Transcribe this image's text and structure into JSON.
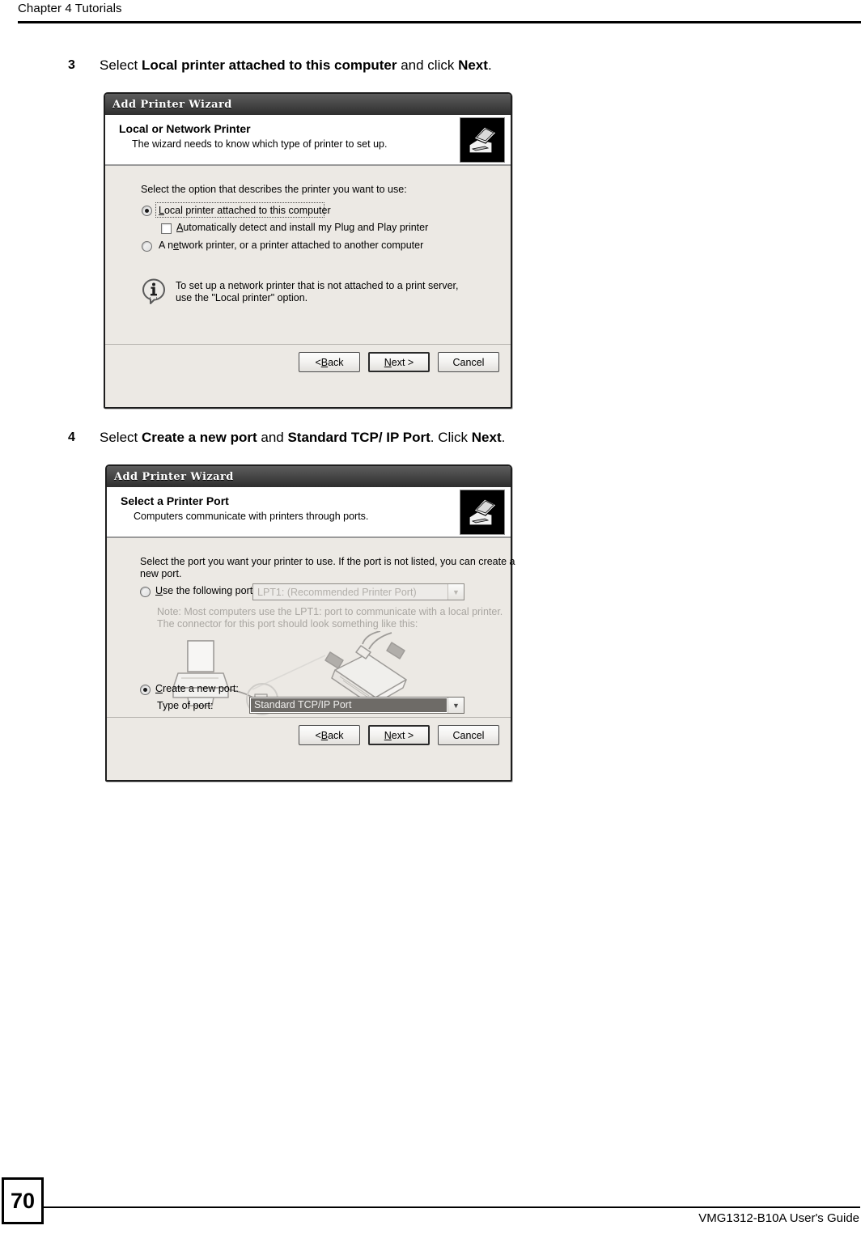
{
  "page": {
    "chapter_header": "Chapter 4 Tutorials",
    "page_number": "70",
    "guide_name": "VMG1312-B10A User's Guide"
  },
  "steps": [
    {
      "number": "3",
      "segments": [
        {
          "text": "Select ",
          "bold": false
        },
        {
          "text": "Local printer attached to this computer",
          "bold": true
        },
        {
          "text": " and click ",
          "bold": false
        },
        {
          "text": "Next",
          "bold": true
        },
        {
          "text": ".",
          "bold": false
        }
      ]
    },
    {
      "number": "4",
      "segments": [
        {
          "text": "Select ",
          "bold": false
        },
        {
          "text": "Create a new port",
          "bold": true
        },
        {
          "text": " and ",
          "bold": false
        },
        {
          "text": "Standard TCP/ IP Port",
          "bold": true
        },
        {
          "text": ". Click ",
          "bold": false
        },
        {
          "text": "Next",
          "bold": true
        },
        {
          "text": ".",
          "bold": false
        }
      ]
    }
  ],
  "dialog1": {
    "title": "Add Printer Wizard",
    "header_title": "Local or Network Printer",
    "header_subtitle": "The wizard needs to know which type of printer to set up.",
    "prompt": "Select the option that describes the printer you want to use:",
    "option_local": "Local printer attached to this computer",
    "option_autodetect": "Automatically detect and install my Plug and Play printer",
    "option_network": "A network printer, or a printer attached to another computer",
    "info_line1": "To set up a network printer that is not attached to a print server,",
    "info_line2": "use the \"Local printer\" option.",
    "buttons": {
      "back": "< Back",
      "next": "Next >",
      "cancel": "Cancel"
    }
  },
  "dialog2": {
    "title": "Add Printer Wizard",
    "header_title": "Select a Printer Port",
    "header_subtitle": "Computers communicate with printers through ports.",
    "prompt_line1": "Select the port you want your printer to use.  If the port is not listed, you can create a",
    "prompt_line2": "new port.",
    "option_use_port": "Use the following port:",
    "port_value": "LPT1: (Recommended Printer Port)",
    "note_line1": "Note: Most computers use the LPT1: port to communicate with a local printer.",
    "note_line2": "The connector for this port should look something like this:",
    "option_create_port": "Create a new port:",
    "type_of_port_label": "Type of port:",
    "type_of_port_value": "Standard TCP/IP Port",
    "buttons": {
      "back": "< Back",
      "next": "Next >",
      "cancel": "Cancel"
    }
  },
  "colors": {
    "dialog_face": "#ece9e4",
    "titlebar_dark": "#3a3a3a",
    "selection": "#6e6b67",
    "page_text": "#000000"
  }
}
